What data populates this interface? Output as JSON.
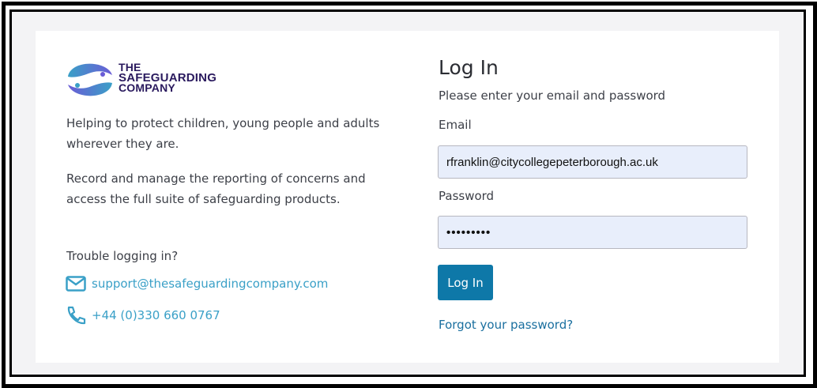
{
  "brand": {
    "line1": "THE",
    "line2": "SAFEGUARDING",
    "line3": "COMPANY",
    "colors": {
      "purple": "#2a1a5e",
      "blue": "#3aa0c7",
      "violet": "#6a5cd6"
    }
  },
  "intro": {
    "paragraph1": "Helping to protect children, young people and adults wherever they are.",
    "paragraph2": "Record and manage the reporting of concerns and access the full suite of safeguarding products."
  },
  "support": {
    "heading": "Trouble logging in?",
    "email": "support@thesafeguardingcompany.com",
    "email_icon": "mail-icon",
    "phone": "+44 (0)330 660 0767",
    "phone_icon": "phone-icon"
  },
  "login": {
    "title": "Log In",
    "subtitle": "Please enter your email and password",
    "email_label": "Email",
    "email_value": "rfranklin@citycollegepeterborough.ac.uk",
    "password_label": "Password",
    "password_value": "•••••••••",
    "button_label": "Log In",
    "forgot_label": "Forgot your password?",
    "accent_color": "#0e78a8"
  }
}
